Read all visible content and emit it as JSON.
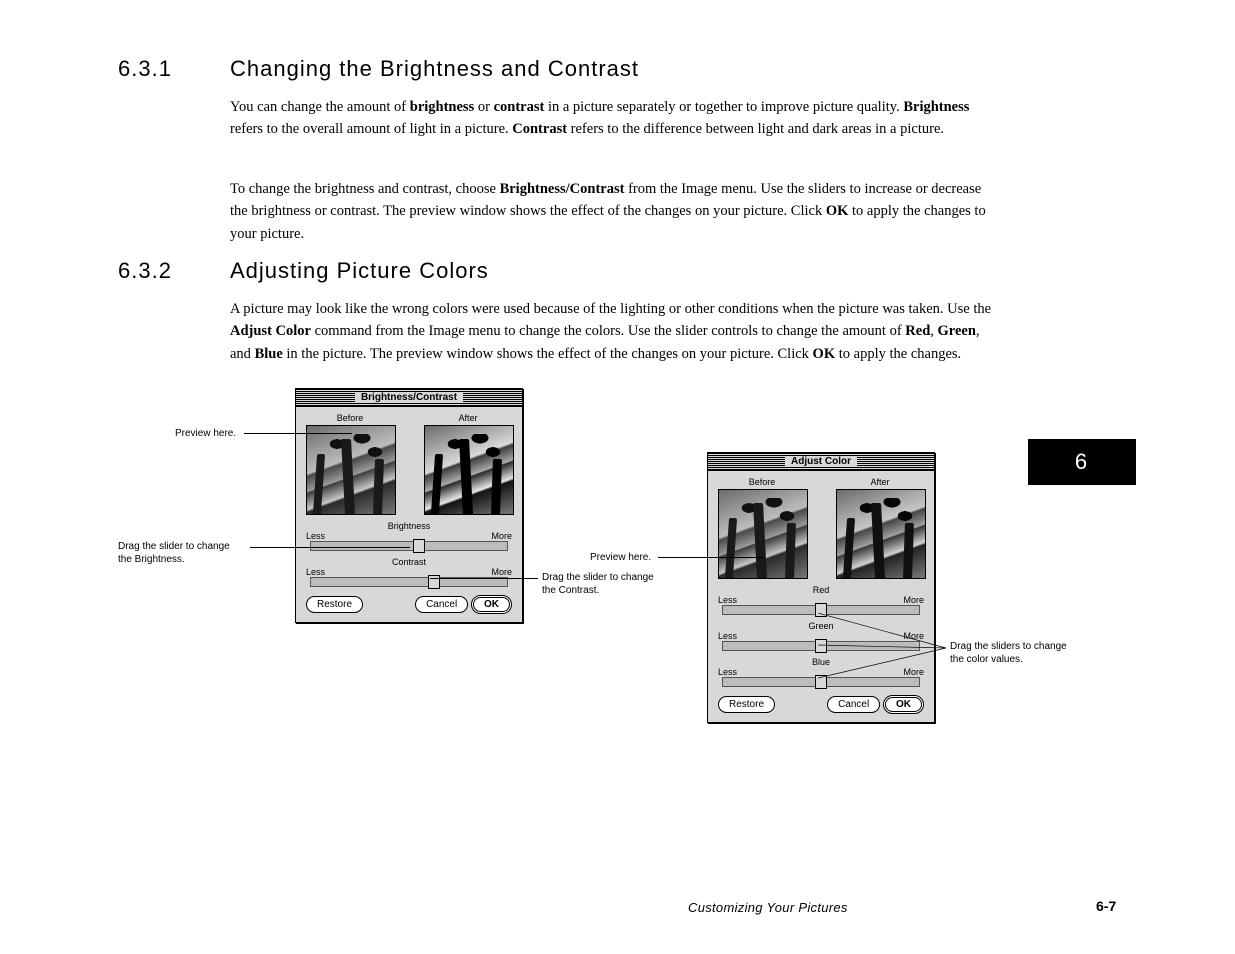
{
  "page": {
    "footer_title": "Customizing Your Pictures",
    "footer_page": "6-7",
    "chapter_tab": "6"
  },
  "sec1": {
    "num": "6.3.1",
    "title": "Changing the Brightness and Contrast",
    "para1_a": "You can change the amount of ",
    "para1_b": "brightness",
    "para1_c": " or ",
    "para1_d": "contrast",
    "para1_e": " in a picture separately or together to improve picture quality. ",
    "para1_f": "Brightness",
    "para1_g": " refers to the overall amount of light in a picture. ",
    "para1_h": "Contrast",
    "para1_i": " refers to the difference between light and dark areas in a picture.",
    "para2_a": "To change the brightness and contrast, choose ",
    "para2_b": "Brightness/Contrast",
    "para2_c": " from the Image menu. Use the sliders to increase or decrease the brightness or contrast. The preview window shows the effect of the changes on your picture. Click ",
    "para2_d": "OK",
    "para2_e": " to apply the changes to your picture.",
    "callouts": {
      "preview": "Preview here.",
      "bright_a": "Drag the slider to change",
      "bright_b": "the Brightness.",
      "contrast_a": "Drag the slider to change",
      "contrast_b": "the Contrast."
    },
    "dialog": {
      "title": "Brightness/Contrast",
      "before": "Before",
      "after": "After",
      "s1": "Brightness",
      "s2": "Contrast",
      "less": "Less",
      "more": "More",
      "restore": "Restore",
      "cancel": "Cancel",
      "ok": "OK"
    }
  },
  "sec2": {
    "num": "6.3.2",
    "title": "Adjusting Picture Colors",
    "para1_a": "A picture may look like the wrong colors were used because of the lighting or other conditions when the picture was taken. Use the ",
    "para1_b": "Adjust Color",
    "para1_c": " command from the Image menu to change the colors. Use the slider controls to change the amount of ",
    "para1_d": "Red",
    "para1_e": ", ",
    "para1_f": "Green",
    "para1_g": ", and ",
    "para1_h": "Blue",
    "para1_i": " in the picture. The preview window shows the effect of the changes on your picture. Click ",
    "para1_j": "OK",
    "para1_k": " to apply the changes.",
    "callouts": {
      "preview": "Preview here.",
      "sliders_a": "Drag the sliders to change",
      "sliders_b": "the color values."
    },
    "dialog": {
      "title": "Adjust Color",
      "before": "Before",
      "after": "After",
      "r": "Red",
      "g": "Green",
      "b": "Blue",
      "less": "Less",
      "more": "More",
      "restore": "Restore",
      "cancel": "Cancel",
      "ok": "OK"
    }
  }
}
